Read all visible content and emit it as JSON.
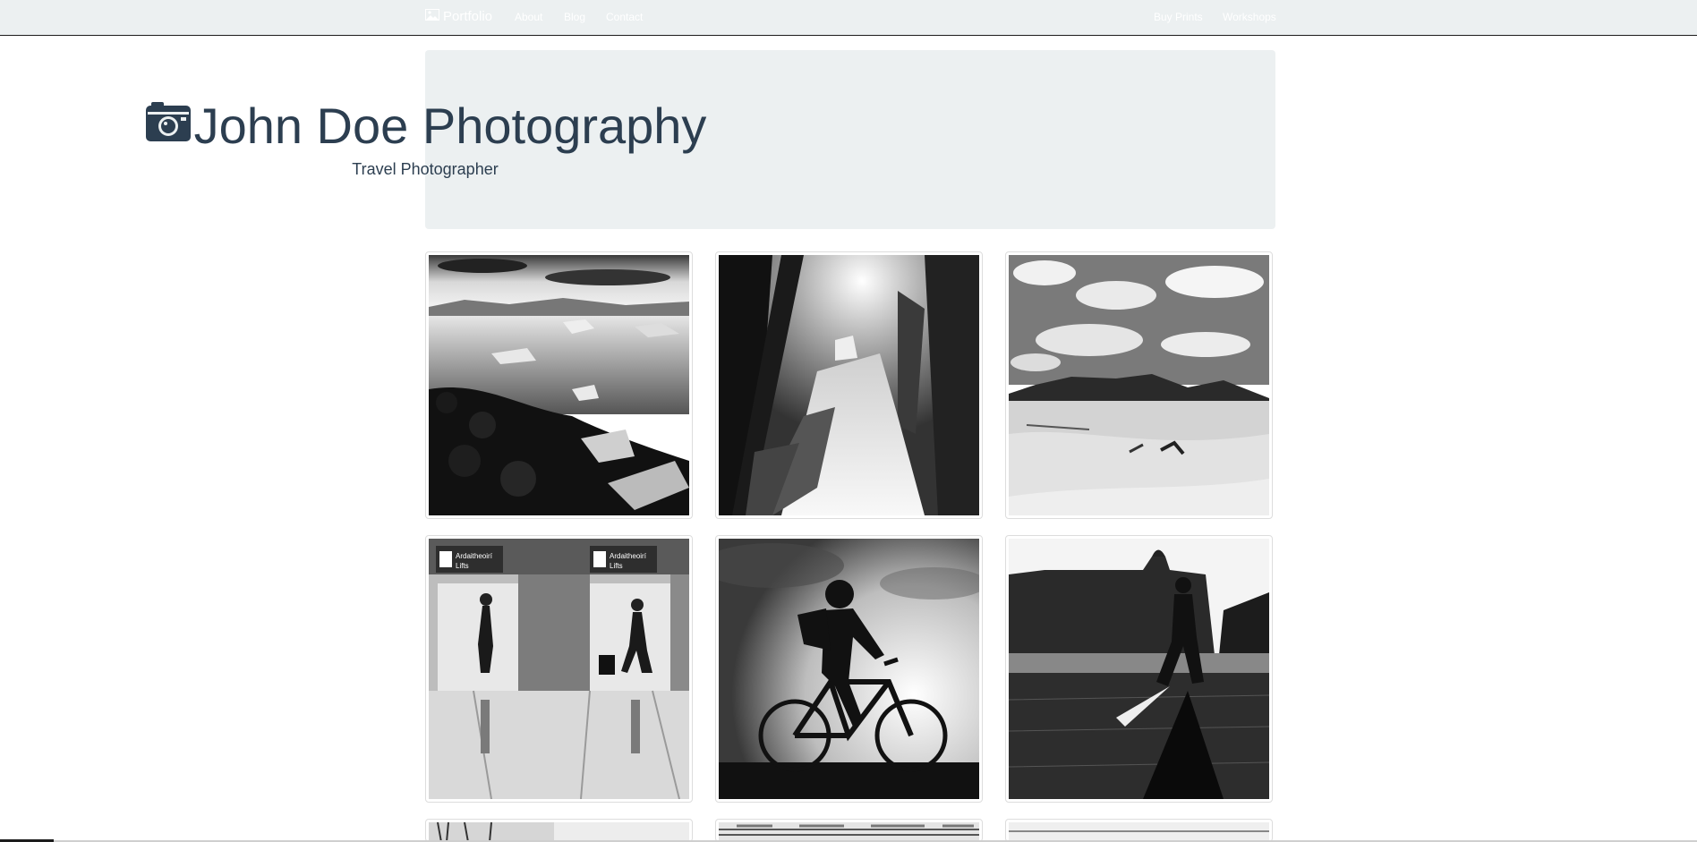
{
  "navbar": {
    "brand": "Portfolio",
    "brand_icon": "picture-icon",
    "links_left": [
      "About",
      "Blog",
      "Contact"
    ],
    "links_right": [
      "Buy Prints",
      "Workshops"
    ]
  },
  "hero": {
    "title": "John Doe Photography",
    "subtitle": "Travel Photographer",
    "icon": "camera-icon"
  },
  "gallery": {
    "photos": [
      {
        "subject": "glacier lagoon"
      },
      {
        "subject": "forest waterfall"
      },
      {
        "subject": "desert dunes"
      },
      {
        "subject": "airport lifts",
        "signs": [
          "Ardaitheoirí",
          "Lifts"
        ]
      },
      {
        "subject": "cyclist silhouette"
      },
      {
        "subject": "walker silhouette"
      },
      {
        "subject": "row 3 photo"
      },
      {
        "subject": "row 3 photo"
      },
      {
        "subject": "row 3 photo"
      }
    ]
  },
  "colors": {
    "navbar_bg": "#ecf0f1",
    "text_dark": "#2c3e50",
    "page_bg": "#ffffff"
  }
}
